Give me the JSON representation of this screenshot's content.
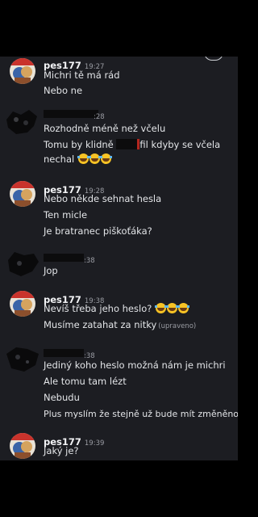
{
  "icons": {
    "scroll_down": "arrow-down-icon",
    "reaction_emoji": "laughing-tears-emoji"
  },
  "colors": {
    "chat_background": "#1c1d22",
    "outer_background": "#000000",
    "username": "#f2f3f5",
    "timestamp": "#9a9ca3",
    "emoji_yellow": "#f7c325"
  },
  "messages": [
    {
      "author": "pes177",
      "time": "19:27",
      "lines": [
        "Michri tě má rád",
        "Nebo ne"
      ]
    },
    {
      "author": "",
      "time": ":28",
      "lines": [
        "Rozhodně méně než včelu",
        "Tomu by klidně",
        "fil kdyby se včela",
        "nechal"
      ]
    },
    {
      "author": "pes177",
      "time": "19:28",
      "lines": [
        "Nebo někde sehnat hesla",
        "Ten micle",
        "Je bratranec piškoťáka?"
      ]
    },
    {
      "author": "",
      "time": ":38",
      "lines": [
        "Jop"
      ]
    },
    {
      "author": "pes177",
      "time": "19:38",
      "lines": [
        "Nevíš třeba jeho heslo?",
        "Musíme zatahat za nitky"
      ],
      "edited": "(upraveno)"
    },
    {
      "author": "",
      "time": ":38",
      "lines": [
        "Jediný koho heslo možná nám je michri",
        "Ale tomu tam lézt",
        "Nebudu",
        "Plus myslím že stejně už bude mít změněno"
      ]
    },
    {
      "author": "pes177",
      "time": "19:39",
      "lines": [
        "Jaký je?"
      ]
    }
  ]
}
